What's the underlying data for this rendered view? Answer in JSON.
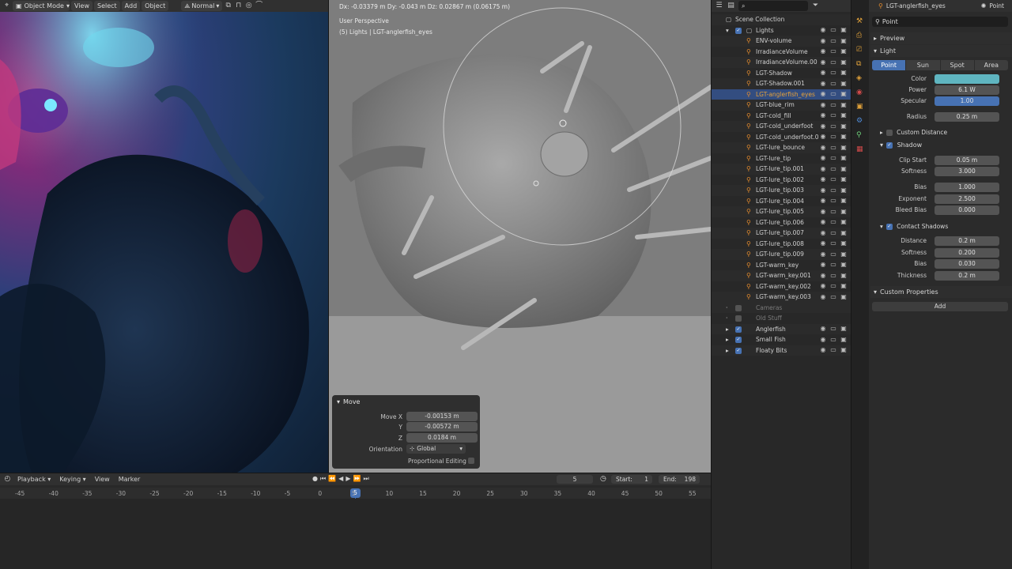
{
  "top_bar": {
    "mode": "Object Mode",
    "menus": [
      "View",
      "Select",
      "Add",
      "Object"
    ],
    "pivot": "Normal",
    "transform_readout": "Dx: -0.03379 m   Dy: -0.043 m   Dz: 0.02867 m (0.06175 m)"
  },
  "viewport": {
    "perspective": "User Perspective",
    "collection_label": "(5) Lights | LGT-anglerfish_eyes"
  },
  "move_panel": {
    "title": "Move",
    "move_x_label": "Move X",
    "move_x": "-0.00153 m",
    "y_label": "Y",
    "y": "-0.00572 m",
    "z_label": "Z",
    "z": "0.0184 m",
    "orientation_label": "Orientation",
    "orientation": "Global",
    "proportional_label": "Proportional Editing"
  },
  "outliner": {
    "root": "Scene Collection",
    "lights_collection": "Lights",
    "items": [
      "ENV-volume",
      "IrradianceVolume",
      "IrradianceVolume.00",
      "LGT-Shadow",
      "LGT-Shadow.001",
      "LGT-anglerfish_eyes",
      "LGT-blue_rim",
      "LGT-cold_fill",
      "LGT-cold_underfoot",
      "LGT-cold_underfoot.0",
      "LGT-lure_bounce",
      "LGT-lure_tip",
      "LGT-lure_tip.001",
      "LGT-lure_tip.002",
      "LGT-lure_tip.003",
      "LGT-lure_tip.004",
      "LGT-lure_tip.005",
      "LGT-lure_tip.006",
      "LGT-lure_tip.007",
      "LGT-lure_tip.008",
      "LGT-lure_tip.009",
      "LGT-warm_key",
      "LGT-warm_key.001",
      "LGT-warm_key.002",
      "LGT-warm_key.003"
    ],
    "other_collections": [
      "Cameras",
      "Old Stuff",
      "Anglerfish",
      "Small Fish",
      "Floaty Bits"
    ],
    "selected": "LGT-anglerfish_eyes"
  },
  "properties": {
    "object_name": "LGT-anglerfish_eyes",
    "type_label": "Point",
    "data_name": "Point",
    "preview": "Preview",
    "light": "Light",
    "light_types": [
      "Point",
      "Sun",
      "Spot",
      "Area"
    ],
    "active_type": "Point",
    "color_label": "Color",
    "color_hex": "#5fb5c0",
    "power_label": "Power",
    "power": "6.1 W",
    "specular_label": "Specular",
    "specular": "1.00",
    "radius_label": "Radius",
    "radius": "0.25 m",
    "custom_distance": "Custom Distance",
    "shadow": "Shadow",
    "clip_start_label": "Clip Start",
    "clip_start": "0.05 m",
    "softness_label": "Softness",
    "softness": "3.000",
    "bias_label": "Bias",
    "bias": "1.000",
    "exponent_label": "Exponent",
    "exponent": "2.500",
    "bleed_bias_label": "Bleed Bias",
    "bleed_bias": "0.000",
    "contact_shadows": "Contact Shadows",
    "distance_label": "Distance",
    "distance": "0.2 m",
    "c_softness_label": "Softness",
    "c_softness": "0.200",
    "c_bias_label": "Bias",
    "c_bias": "0.030",
    "thickness_label": "Thickness",
    "thickness": "0.2 m",
    "custom_properties": "Custom Properties",
    "add": "Add"
  },
  "timeline": {
    "menus": [
      "Playback",
      "Keying",
      "View",
      "Marker"
    ],
    "current_frame": "5",
    "start_label": "Start:",
    "start": "1",
    "end_label": "End:",
    "end": "198",
    "ticks": [
      "-45",
      "-40",
      "-35",
      "-30",
      "-25",
      "-20",
      "-15",
      "-10",
      "-5",
      "0",
      "5",
      "10",
      "15",
      "20",
      "25",
      "30",
      "35",
      "40",
      "45",
      "50",
      "55"
    ]
  },
  "colors": {
    "accent": "#4772b3",
    "light_icon": "#e58b2c",
    "selected_text": "#e6a23a"
  }
}
